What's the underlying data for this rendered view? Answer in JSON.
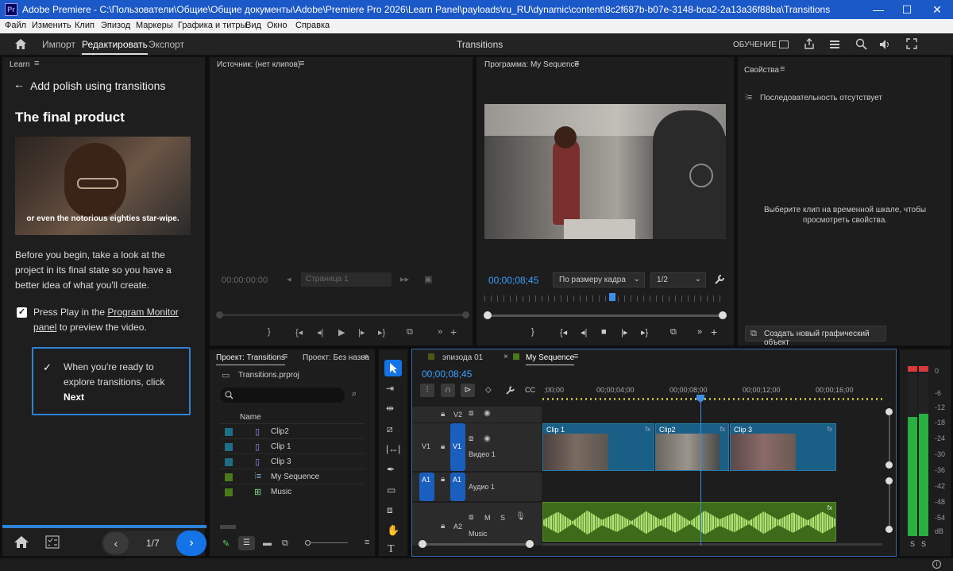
{
  "window": {
    "title": "Adobe Premiere - C:\\Пользователи\\Общие\\Общие документы\\Adobe\\Premiere Pro 2026\\Learn Panel\\payloads\\ru_RU\\dynamic\\content\\8c2f687b-b07e-3148-bca2-2a13a36f88ba\\Transitions",
    "app_badge": "Pr",
    "min": "—",
    "max": "☐",
    "close": "✕"
  },
  "menu": [
    "Файл",
    "Изменить",
    "Клип",
    "Эпизод",
    "Маркеры",
    "Графика и титры",
    "Вид",
    "Окно",
    "Справка"
  ],
  "appbar": {
    "tabs": [
      "Импорт",
      "Редактировать",
      "Экспорт"
    ],
    "active_tab": "Редактировать",
    "center_title": "Transitions",
    "learning": "ОБУЧЕНИЕ"
  },
  "learn": {
    "panel_title": "Learn",
    "back_label": "Add polish using transitions",
    "heading": "The final product",
    "video_caption": "or even the notorious eighties star-wipe.",
    "intro": "Before you begin, take a look at the project in its final state so you have a better idea of what you'll create.",
    "task_prefix": "Press Play in the ",
    "task_link": "Program Monitor panel",
    "task_suffix": " to preview the video.",
    "done_line1": "When you're ready to explore transitions, click",
    "done_bold": "Next",
    "page": "1/7"
  },
  "source": {
    "title": "Источник: (нет клипов)",
    "timecode": "00:00:00:00",
    "page_field": "Страница 1"
  },
  "program": {
    "title": "Программа: My Sequence",
    "timecode": "00;00;08;45",
    "fit": "По размеру кадра",
    "resolution": "1/2"
  },
  "properties": {
    "title": "Свойства",
    "no_sequence": "Последовательность отсутствует",
    "hint": "Выберите клип на временной шкале, чтобы просмотреть свойства.",
    "create_button": "Создать новый графический объект"
  },
  "project": {
    "tab1": "Проект: Transitions",
    "tab2": "Проект: Без назва",
    "file": "Transitions.prproj",
    "column_name": "Name",
    "items": [
      {
        "name": "Clip2",
        "color": "#1e6e8a",
        "type": "clip"
      },
      {
        "name": "Clip 1",
        "color": "#1e6e8a",
        "type": "clip"
      },
      {
        "name": "Clip 3",
        "color": "#1e6e8a",
        "type": "clip"
      },
      {
        "name": "My Sequence",
        "color": "#4a7a1a",
        "type": "sequence"
      },
      {
        "name": "Music",
        "color": "#4a7a1a",
        "type": "audio"
      }
    ]
  },
  "timeline": {
    "tab1": "эпизода 01",
    "tab2": "My Sequence",
    "timecode": "00;00;08;45",
    "ruler": [
      ";00;00",
      "00;00;04;00",
      "00;00;08;00",
      "00;00;12;00",
      "00;00;16;00"
    ],
    "tracks": {
      "v2": "V2",
      "v1": "V1",
      "v1_src": "V1",
      "v1_name": "Видео 1",
      "a1": "A1",
      "a1_src": "A1",
      "a1_name": "Аудио 1",
      "a2": "A2",
      "a2_name": "Music"
    },
    "clips": [
      "Clip 1",
      "Clip2",
      "Clip 3"
    ],
    "fx": "fx",
    "mute": "M",
    "solo": "S"
  },
  "meter": {
    "labels": [
      "0",
      "-6",
      "-12",
      "-18",
      "-24",
      "-30",
      "-36",
      "-42",
      "-48",
      "-54",
      "dB"
    ],
    "ch": [
      "S",
      "S"
    ]
  }
}
